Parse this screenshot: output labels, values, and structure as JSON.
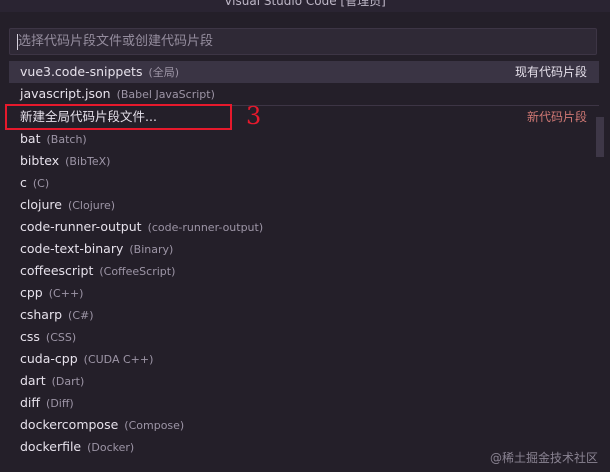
{
  "window": {
    "title": "Visual Studio Code [管理员]"
  },
  "search": {
    "placeholder": "选择代码片段文件或创建代码片段",
    "value": ""
  },
  "items": [
    {
      "name": "vue3.code-snippets",
      "detail": "(全局)",
      "right": "现有代码片段"
    },
    {
      "name": "javascript.json",
      "detail": "(Babel JavaScript)",
      "right": ""
    },
    {
      "name": "新建全局代码片段文件...",
      "detail": "",
      "right": "新代码片段"
    },
    {
      "name": "bat",
      "detail": "(Batch)",
      "right": ""
    },
    {
      "name": "bibtex",
      "detail": "(BibTeX)",
      "right": ""
    },
    {
      "name": "c",
      "detail": "(C)",
      "right": ""
    },
    {
      "name": "clojure",
      "detail": "(Clojure)",
      "right": ""
    },
    {
      "name": "code-runner-output",
      "detail": "(code-runner-output)",
      "right": ""
    },
    {
      "name": "code-text-binary",
      "detail": "(Binary)",
      "right": ""
    },
    {
      "name": "coffeescript",
      "detail": "(CoffeeScript)",
      "right": ""
    },
    {
      "name": "cpp",
      "detail": "(C++)",
      "right": ""
    },
    {
      "name": "csharp",
      "detail": "(C#)",
      "right": ""
    },
    {
      "name": "css",
      "detail": "(CSS)",
      "right": ""
    },
    {
      "name": "cuda-cpp",
      "detail": "(CUDA C++)",
      "right": ""
    },
    {
      "name": "dart",
      "detail": "(Dart)",
      "right": ""
    },
    {
      "name": "diff",
      "detail": "(Diff)",
      "right": ""
    },
    {
      "name": "dockercompose",
      "detail": "(Compose)",
      "right": ""
    },
    {
      "name": "dockerfile",
      "detail": "(Docker)",
      "right": ""
    }
  ],
  "annotation": {
    "step_number": "3"
  },
  "watermark": {
    "text": "@稀土掘金技术社区"
  },
  "colors": {
    "background": "#241f29",
    "active_row": "#3a3444",
    "accent_label": "#d07874",
    "annotation_red": "#e6192c"
  }
}
